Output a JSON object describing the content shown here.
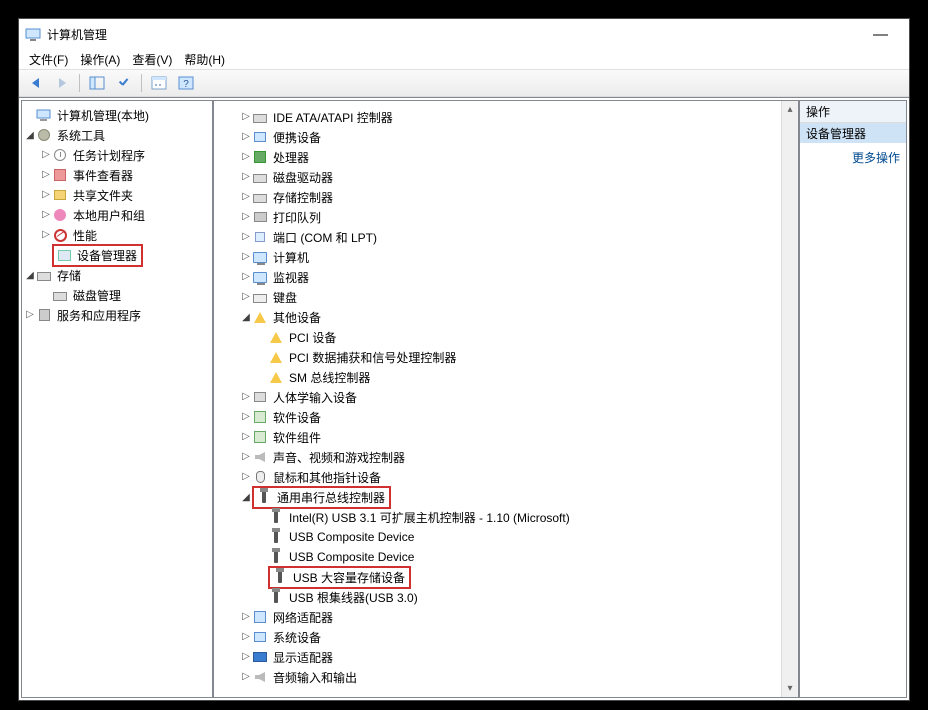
{
  "glyphs": {
    "closed": "▷",
    "open": "◢",
    "none": ""
  },
  "window": {
    "title": "计算机管理",
    "minimize": "—"
  },
  "menu": {
    "file": "文件(F)",
    "action": "操作(A)",
    "view": "查看(V)",
    "help": "帮助(H)"
  },
  "left_tree": {
    "root": "计算机管理(本地)",
    "sys_tools": "系统工具",
    "task_sched": "任务计划程序",
    "event_viewer": "事件查看器",
    "shared_folders": "共享文件夹",
    "local_users": "本地用户和组",
    "performance": "性能",
    "device_mgr": "设备管理器",
    "storage": "存储",
    "disk_mgmt": "磁盘管理",
    "services_apps": "服务和应用程序"
  },
  "center": {
    "ide": "IDE ATA/ATAPI 控制器",
    "portable": "便携设备",
    "processors": "处理器",
    "disk_drives": "磁盘驱动器",
    "storage_ctrl": "存储控制器",
    "print_queues": "打印队列",
    "ports": "端口 (COM 和 LPT)",
    "computer": "计算机",
    "monitors": "监视器",
    "keyboards": "键盘",
    "other": "其他设备",
    "other_pci": "PCI 设备",
    "other_pcicap": "PCI 数据捕获和信号处理控制器",
    "other_sm": "SM 总线控制器",
    "hid": "人体学输入设备",
    "software_devices": "软件设备",
    "software_components": "软件组件",
    "sound": "声音、视频和游戏控制器",
    "mice": "鼠标和其他指针设备",
    "usb_ctrl": "通用串行总线控制器",
    "usb_intel": "Intel(R) USB 3.1 可扩展主机控制器 - 1.10 (Microsoft)",
    "usb_comp1": "USB Composite Device",
    "usb_comp2": "USB Composite Device",
    "usb_mass": "USB 大容量存储设备",
    "usb_root": "USB 根集线器(USB 3.0)",
    "network": "网络适配器",
    "system_devices": "系统设备",
    "display": "显示适配器",
    "audio_io": "音频输入和输出"
  },
  "right": {
    "header": "操作",
    "selected": "设备管理器",
    "more": "更多操作"
  }
}
